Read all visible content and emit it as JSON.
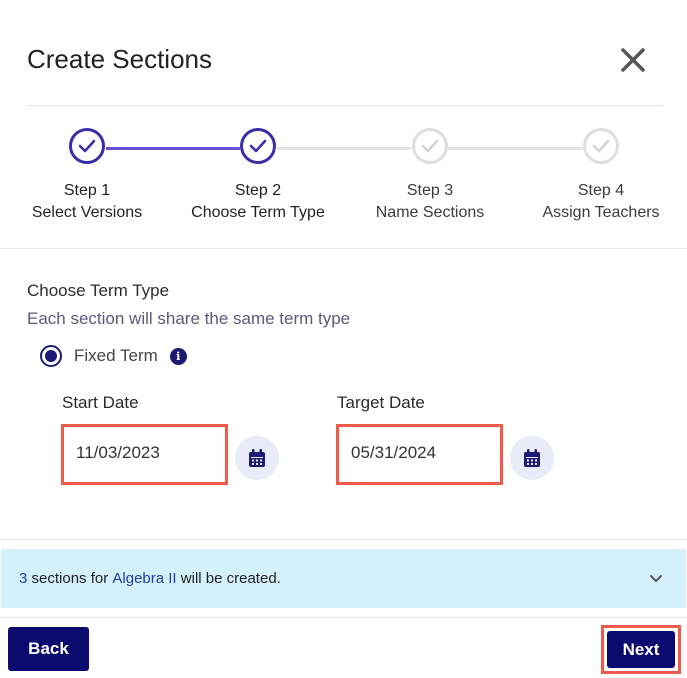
{
  "dialog": {
    "title": "Create Sections"
  },
  "stepper": {
    "steps": [
      {
        "number": "Step 1",
        "name": "Select Versions",
        "state": "complete"
      },
      {
        "number": "Step 2",
        "name": "Choose Term Type",
        "state": "complete"
      },
      {
        "number": "Step 3",
        "name": "Name Sections",
        "state": "incomplete"
      },
      {
        "number": "Step 4",
        "name": "Assign Teachers",
        "state": "incomplete"
      }
    ]
  },
  "term": {
    "heading": "Choose Term Type",
    "subheading": "Each section will share the same term type",
    "option_label": "Fixed Term",
    "option_selected": true,
    "start_label": "Start Date",
    "start_value": "11/03/2023",
    "target_label": "Target Date",
    "target_value": "05/31/2024"
  },
  "banner": {
    "count": "3",
    "text_1": " sections for ",
    "course": "Algebra II",
    "text_2": " will be created."
  },
  "footer": {
    "back_label": "Back",
    "next_label": "Next"
  },
  "colors": {
    "primary": "#0b0a6e",
    "step_active": "#3a2ea8",
    "step_inactive": "#dedede",
    "highlight_outline": "#f05a4a",
    "banner_bg": "#d4f0fc"
  }
}
